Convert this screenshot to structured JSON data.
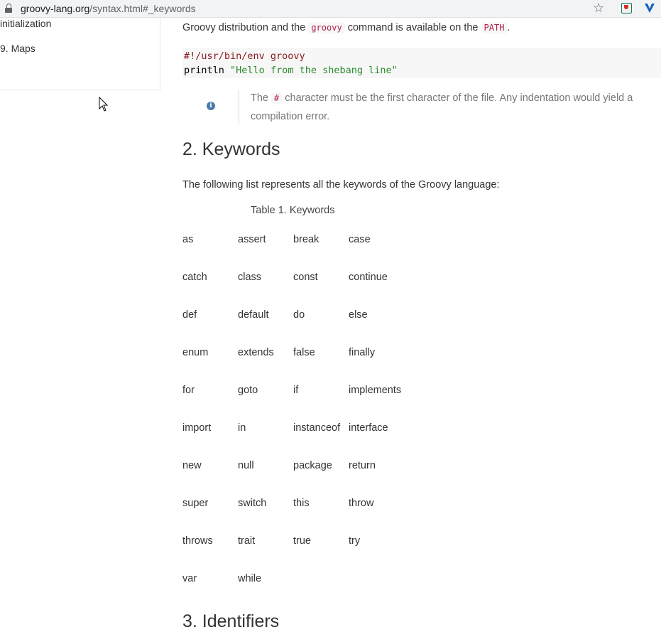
{
  "browser": {
    "url_host": "groovy-lang.org",
    "url_path": "/syntax.html#_keywords",
    "icons": [
      "lock-icon",
      "star-icon",
      "extension-icon",
      "extension-icon"
    ]
  },
  "sidebar": {
    "items": [
      {
        "label": "initialization"
      },
      {
        "label": "9. Maps"
      }
    ]
  },
  "content": {
    "intro": {
      "before": "Groovy distribution and the ",
      "code1": "groovy",
      "middle": " command is available on the ",
      "code2": "PATH",
      "after": "."
    },
    "codeblock": {
      "line1": "#!/usr/bin/env groovy",
      "line2_kw": "println",
      "line2_str": "\"Hello from the shebang line\""
    },
    "note": {
      "icon": "info-icon",
      "before": "The ",
      "code": "#",
      "after": " character must be the first character of the file. Any indentation would yield a compilation error."
    },
    "section2": {
      "title": "2. Keywords",
      "description": "The following list represents all the keywords of the Groovy language:",
      "table_caption": "Table 1. Keywords",
      "keywords": [
        [
          "as",
          "assert",
          "break",
          "case"
        ],
        [
          "catch",
          "class",
          "const",
          "continue"
        ],
        [
          "def",
          "default",
          "do",
          "else"
        ],
        [
          "enum",
          "extends",
          "false",
          "finally"
        ],
        [
          "for",
          "goto",
          "if",
          "implements"
        ],
        [
          "import",
          "in",
          "instanceof",
          "interface"
        ],
        [
          "new",
          "null",
          "package",
          "return"
        ],
        [
          "super",
          "switch",
          "this",
          "throw"
        ],
        [
          "throws",
          "trait",
          "true",
          "try"
        ],
        [
          "var",
          "while",
          "",
          ""
        ]
      ]
    },
    "section3": {
      "title": "3. Identifiers"
    }
  }
}
